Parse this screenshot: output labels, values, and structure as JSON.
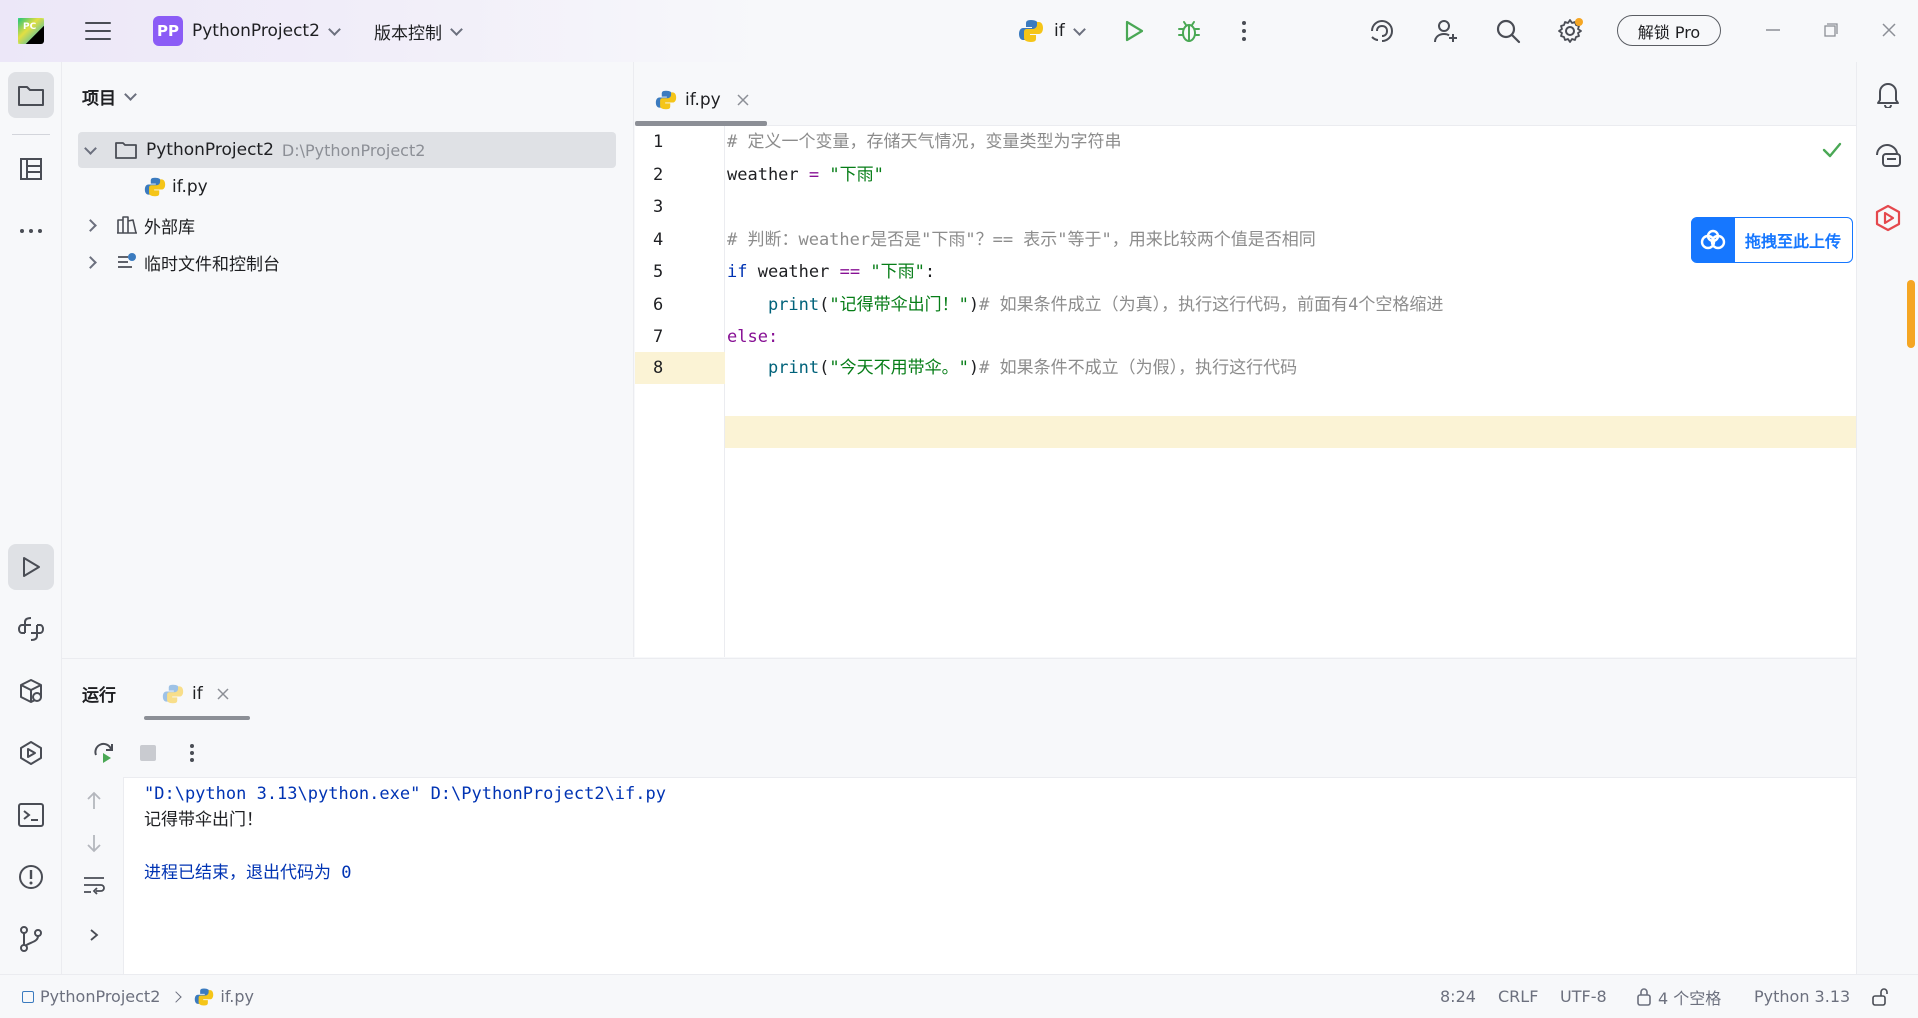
{
  "titlebar": {
    "app_badge": "PC",
    "project_badge": "PP",
    "project_name": "PythonProject2",
    "vcs_label": "版本控制",
    "run_config": "if",
    "pro_label": "解锁 Pro"
  },
  "project_panel": {
    "title": "项目",
    "root_name": "PythonProject2",
    "root_path": "D:\\PythonProject2",
    "file_name": "if.py",
    "external_libs": "外部库",
    "scratches": "临时文件和控制台"
  },
  "editor": {
    "tab_name": "if.py",
    "line_numbers": [
      "1",
      "2",
      "3",
      "4",
      "5",
      "6",
      "7",
      "8"
    ],
    "lines": {
      "l1_comment": "# 定义一个变量，存储天气情况，变量类型为字符串",
      "l2_var": "weather",
      "l2_op": " = ",
      "l2_str": "\"下雨\"",
      "l4_comment": "# 判断：weather是否是\"下雨\"？== 表示\"等于\"，用来比较两个值是否相同",
      "l5_kw": "if",
      "l5_var": " weather ",
      "l5_op": "==",
      "l5_str": " \"下雨\"",
      "l5_colon": ":",
      "l6_indent": "    ",
      "l6_fn": "print",
      "l6_paren_open": "(",
      "l6_str": "\"记得带伞出门！\"",
      "l6_paren_close": ")",
      "l6_comment": "# 如果条件成立（为真），执行这行代码，前面有4个空格缩进",
      "l7_kw": "else",
      "l7_colon": ":",
      "l8_indent": "    ",
      "l8_fn": "print",
      "l8_paren_open": "(",
      "l8_str": "\"今天不用带伞。\"",
      "l8_paren_close": ")",
      "l8_comment": "# 如果条件不成立（为假），执行这行代码"
    },
    "upload_label": "拖拽至此上传"
  },
  "run_panel": {
    "title": "运行",
    "tab_name": "if",
    "output": {
      "cmd": "\"D:\\python 3.13\\python.exe\" D:\\PythonProject2\\if.py",
      "line1": "记得带伞出门！",
      "exit": "进程已结束，退出代码为 0"
    }
  },
  "statusbar": {
    "project": "PythonProject2",
    "file": "if.py",
    "position": "8:24",
    "line_sep": "CRLF",
    "encoding": "UTF-8",
    "indent": "4 个空格",
    "interpreter": "Python 3.13"
  },
  "colors": {
    "accent": "#8b5cf6",
    "run_green": "#4aa855",
    "keyword": "#0033b3",
    "string": "#067d17",
    "comment": "#8c8c8c",
    "highlight_line": "#fbf3d5",
    "upload_blue": "#1677ff"
  }
}
